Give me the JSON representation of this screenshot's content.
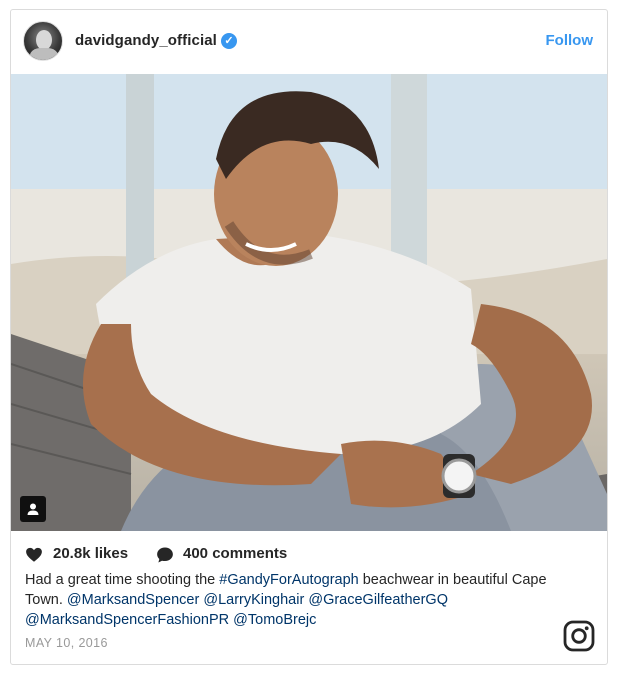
{
  "post": {
    "username": "davidgandy_official",
    "verified_mark": "✓",
    "follow_label": "Follow",
    "likes": "20.8k likes",
    "comments": "400 comments",
    "caption": {
      "part1": "Had a great time shooting the ",
      "hashtag": "#GandyForAutograph",
      "part2": " beachwear in beautiful Cape Town. ",
      "mention1": "@MarksandSpencer",
      "mention2": "@LarryKinghair",
      "mention3": "@GraceGilfeatherGQ",
      "mention4": "@MarksandSpencerFashionPR",
      "mention5": "@TomoBrejc"
    },
    "date": "MAY 10, 2016"
  },
  "icons": {
    "heart": "heart-icon",
    "comment": "comment-bubble-icon",
    "tagged_user": "tagged-user-icon",
    "instagram": "instagram-logo-icon"
  },
  "colors": {
    "link": "#003569",
    "follow": "#3897f0",
    "text": "#262626",
    "muted": "#999999"
  }
}
